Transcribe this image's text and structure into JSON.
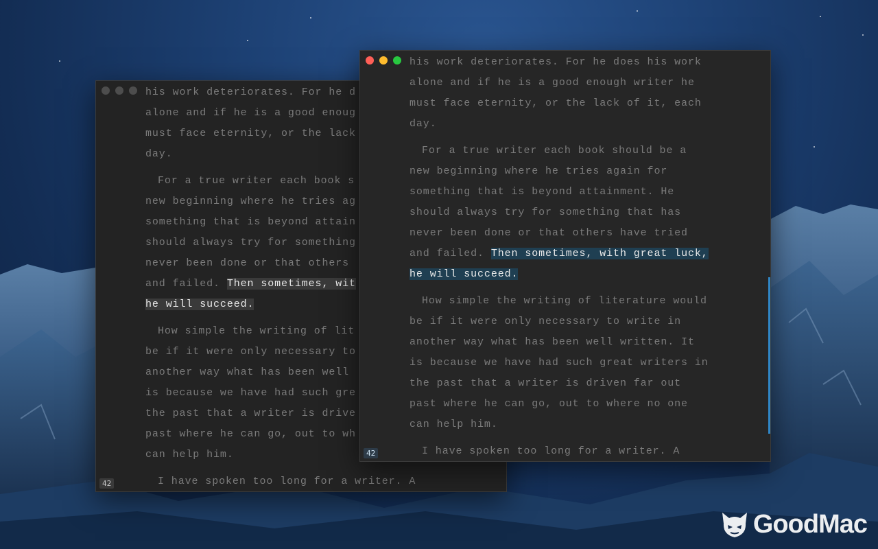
{
  "back_window": {
    "paragraphs": [
      {
        "lines": [
          "his work deteriorates. For he d",
          "alone and if he is a good enoug",
          "must face eternity, or the lack",
          "day."
        ]
      },
      {
        "lines": [
          "For a true writer each book s",
          "new beginning where he tries ag",
          "something that is beyond attain",
          "should always try for something",
          "never been done or that others"
        ]
      },
      {
        "lines": [
          "How simple the writing of lit",
          "be if it were only necessary to",
          "another way what has been well",
          "is because we have had such gre",
          "the past that a writer is drive",
          "past where he can go, out to wh",
          "can help him."
        ]
      },
      {
        "lines": [
          "I have spoken too long for a writer. A"
        ]
      }
    ],
    "highlight_pre": "and failed. ",
    "highlight_line1": "Then sometimes, wit",
    "highlight_line2": "he will succeed.",
    "line_badge": "42"
  },
  "front_window": {
    "paragraphs": [
      {
        "lines": [
          "his work deteriorates. For he does his work",
          "alone and if he is a good enough writer he",
          "must face eternity, or the lack of it, each",
          "day."
        ]
      },
      {
        "lines": [
          "For a true writer each book should be a",
          "new beginning where he tries again for",
          "something that is beyond attainment. He",
          "should always try for something that has",
          "never been done or that others have tried"
        ]
      },
      {
        "lines": [
          "How simple the writing of literature would",
          "be if it were only necessary to write in",
          "another way what has been well written. It",
          "is because we have had such great writers in",
          "the past that a writer is driven far out",
          "past where he can go, out to where no one",
          "can help him."
        ]
      },
      {
        "lines": [
          "I have spoken too long for a writer. A"
        ]
      }
    ],
    "highlight_pre": "and failed. ",
    "highlight_line1": "Then sometimes, with great luck,",
    "highlight_line2": "he will succeed.",
    "line_badge": "42"
  },
  "watermark": {
    "text": "GoodMac",
    "icon": "devil-cat-icon"
  }
}
